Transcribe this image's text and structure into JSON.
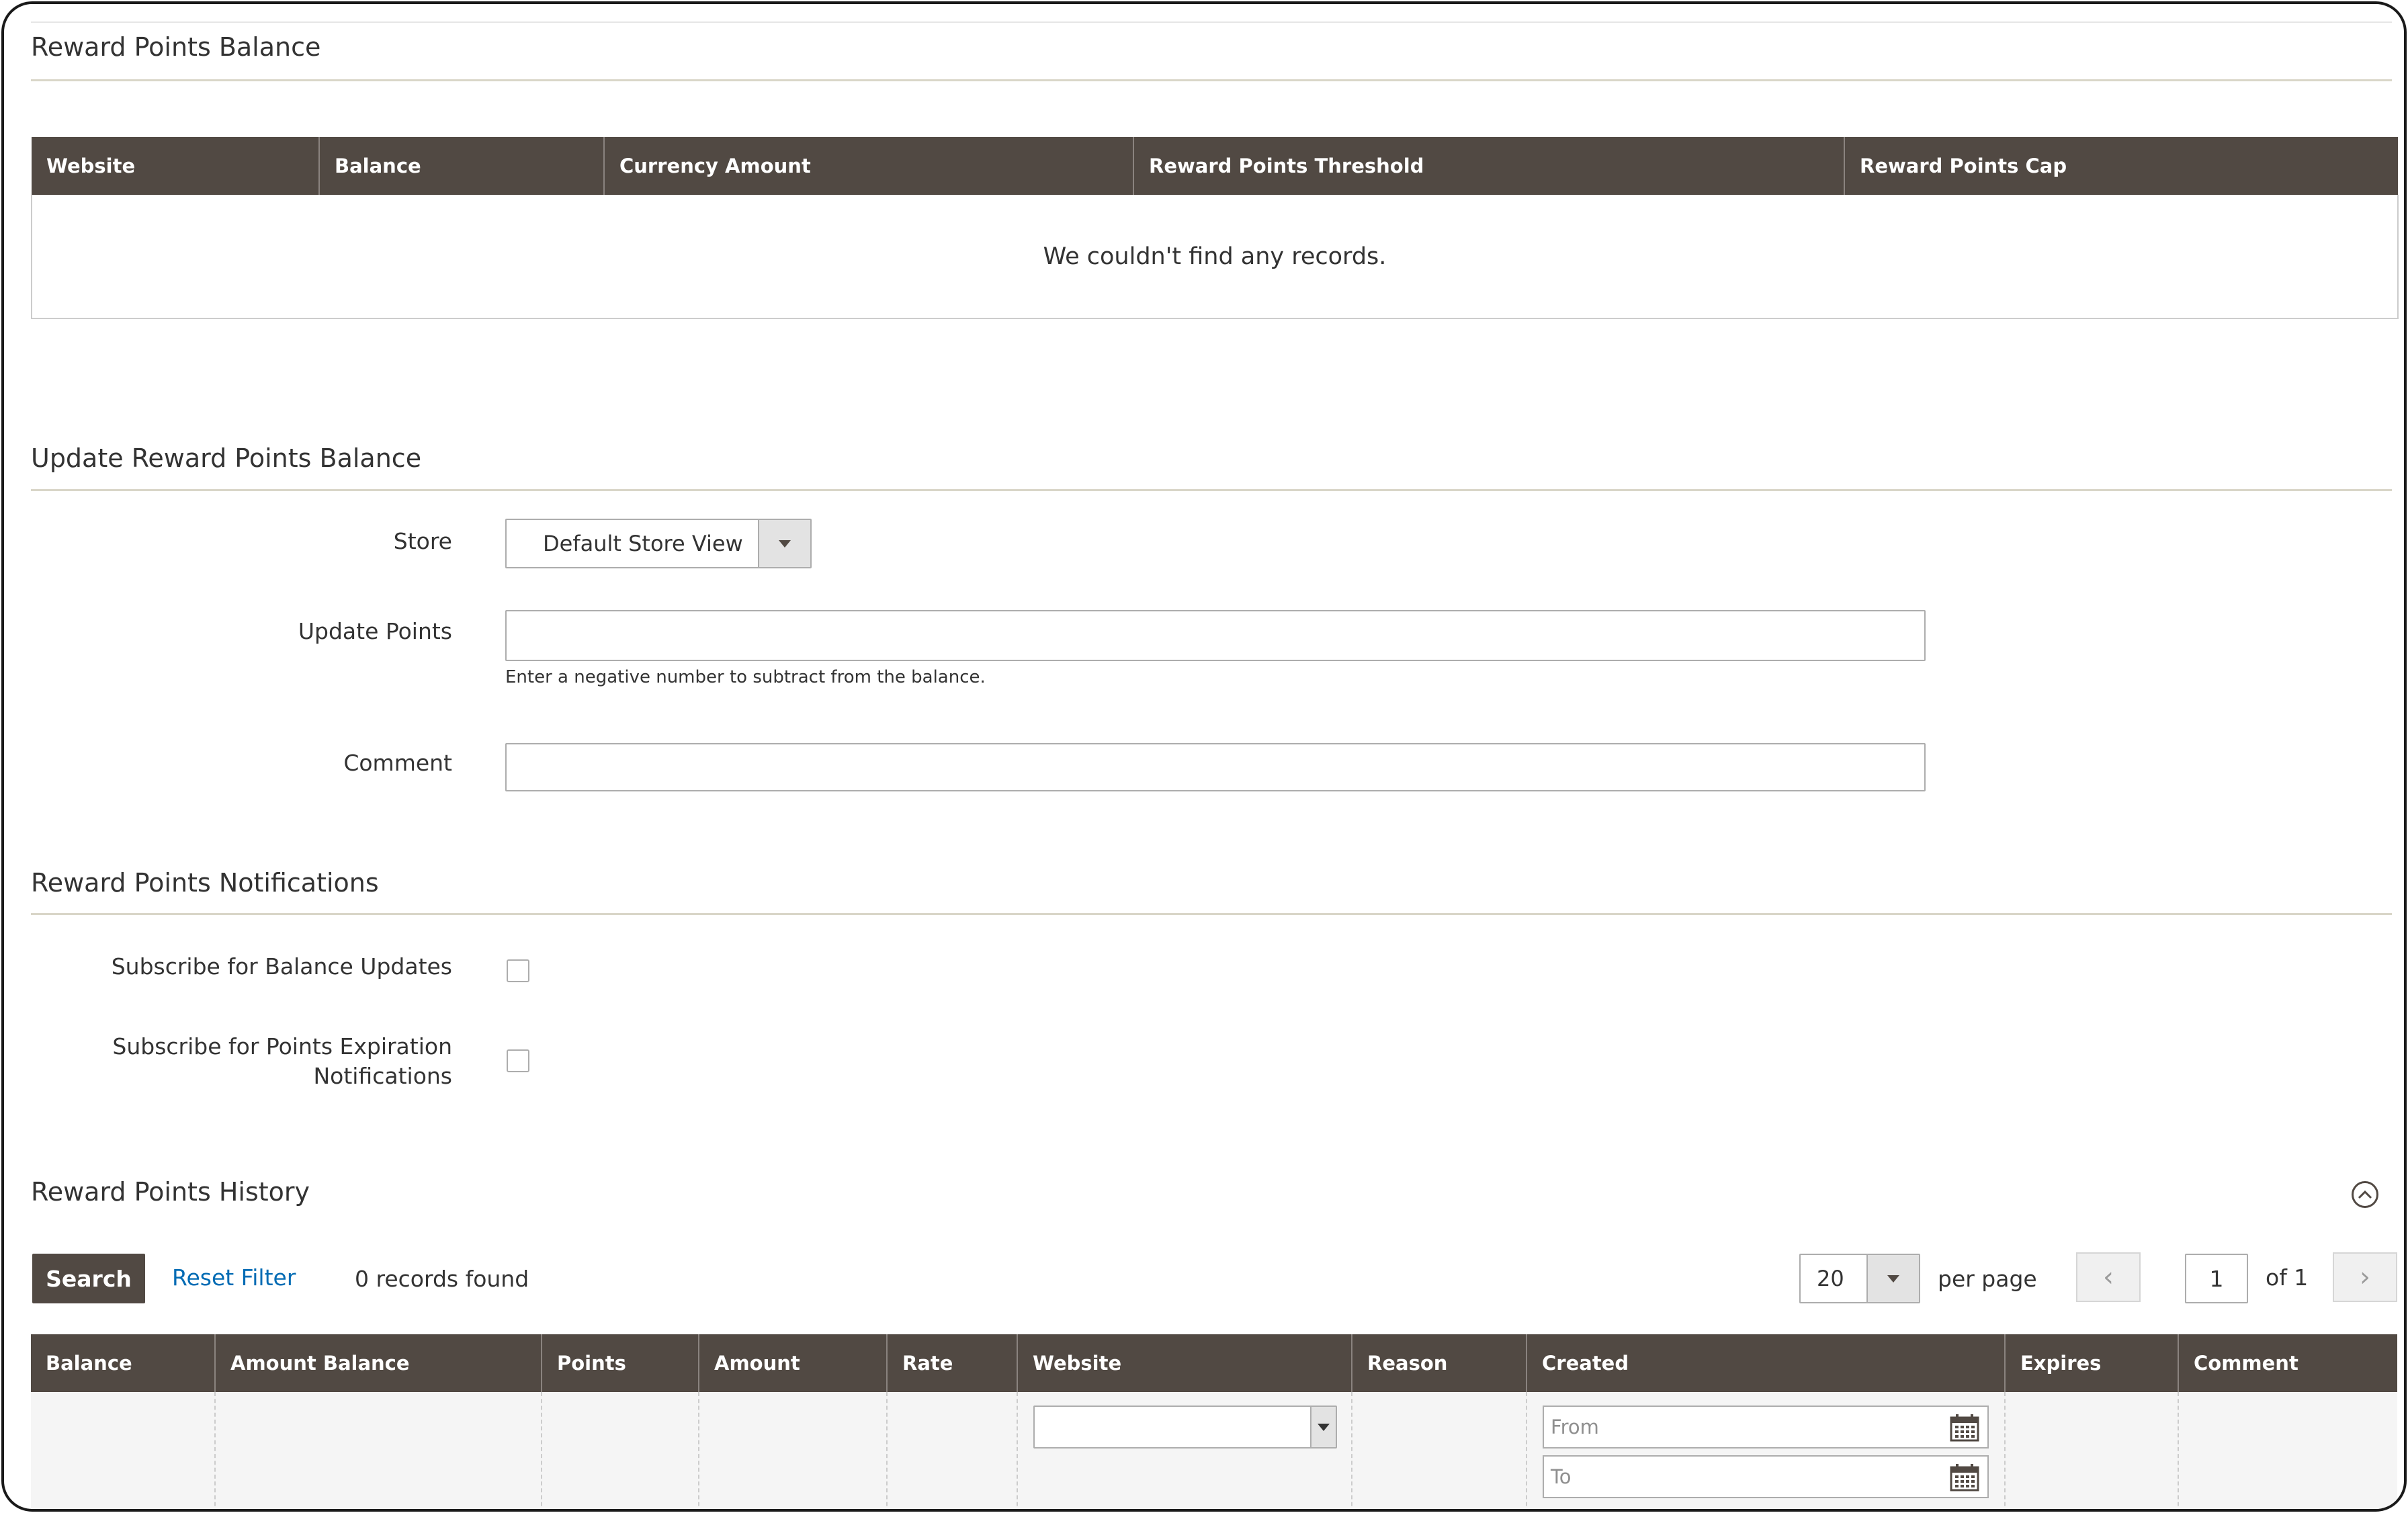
{
  "balance_section": {
    "title": "Reward Points Balance",
    "columns": [
      "Website",
      "Balance",
      "Currency Amount",
      "Reward Points Threshold",
      "Reward Points Cap"
    ],
    "empty_message": "We couldn't find any records."
  },
  "update_section": {
    "title": "Update Reward Points Balance",
    "store_label": "Store",
    "store_value": "Default Store View",
    "update_points_label": "Update Points",
    "update_points_value": "",
    "update_points_note": "Enter a negative number to subtract from the balance.",
    "comment_label": "Comment",
    "comment_value": ""
  },
  "notifications_section": {
    "title": "Reward Points Notifications",
    "subscribe_balance_label": "Subscribe for Balance Updates",
    "subscribe_expiration_label_line1": "Subscribe for Points Expiration",
    "subscribe_expiration_label_line2": "Notifications",
    "subscribe_balance_checked": false,
    "subscribe_expiration_checked": false
  },
  "history_section": {
    "title": "Reward Points History",
    "search_label": "Search",
    "reset_filter_label": "Reset Filter",
    "records_found": "0 records found",
    "per_page_value": "20",
    "per_page_label": "per page",
    "current_page": "1",
    "total_pages_label": "of 1",
    "columns": [
      "Balance",
      "Amount Balance",
      "Points",
      "Amount",
      "Rate",
      "Website",
      "Reason",
      "Created",
      "Expires",
      "Comment"
    ],
    "created_from_placeholder": "From",
    "created_to_placeholder": "To"
  },
  "colors": {
    "header_bg": "#514943",
    "link": "#006bb4",
    "border": "#adadad"
  }
}
